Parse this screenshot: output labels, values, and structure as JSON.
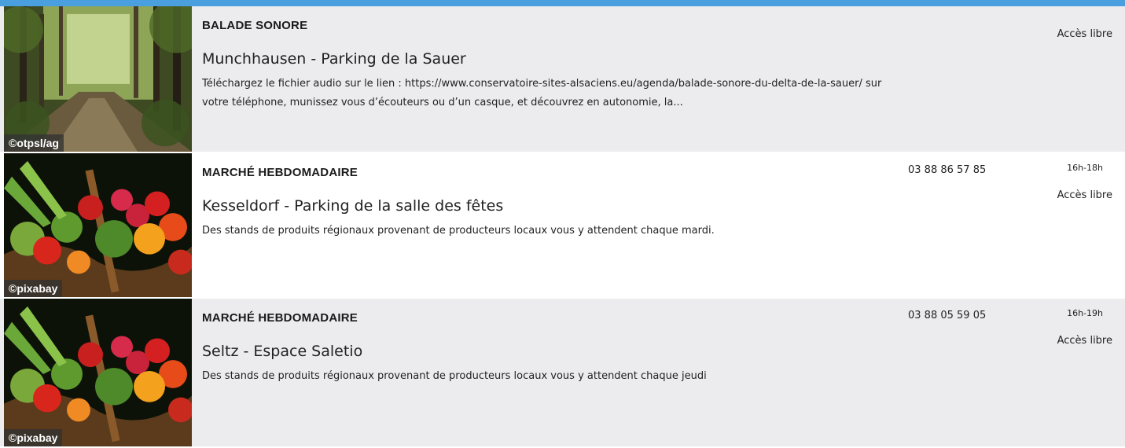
{
  "events": [
    {
      "category": "BALADE SONORE",
      "place": "Munchhausen - Parking de la Sauer",
      "description": "Téléchargez le fichier audio sur le lien : https://www.conservatoire-sites-alsaciens.eu/agenda/balade-sonore-du-delta-de-la-sauer/ sur votre téléphone, munissez vous d’écouteurs ou d’un casque, et découvrez en autonomie, la...",
      "access": "Accès libre",
      "image_credit": "©otpsl/ag"
    },
    {
      "category": "MARCHÉ HEBDOMADAIRE",
      "place": "Kesseldorf - Parking de la salle des fêtes",
      "description": "Des stands de produits régionaux provenant de producteurs locaux vous y attendent chaque mardi.",
      "phone": "03 88 86 57 85",
      "hours": "16h-18h",
      "access": "Accès libre",
      "image_credit": "©pixabay"
    },
    {
      "category": "MARCHÉ HEBDOMADAIRE",
      "place": "Seltz - Espace Saletio",
      "description": "Des stands de produits régionaux provenant de producteurs locaux vous y attendent chaque jeudi",
      "phone": "03 88 05 59 05",
      "hours": "16h-19h",
      "access": "Accès libre",
      "image_credit": "©pixabay"
    }
  ],
  "colors": {
    "accent_bar": "#4a9fde",
    "row_alt_background": "#ececee"
  },
  "icons": {
    "forest_path_photo": "forest-path-photo",
    "vegetable_basket_photo": "vegetable-basket-photo"
  }
}
